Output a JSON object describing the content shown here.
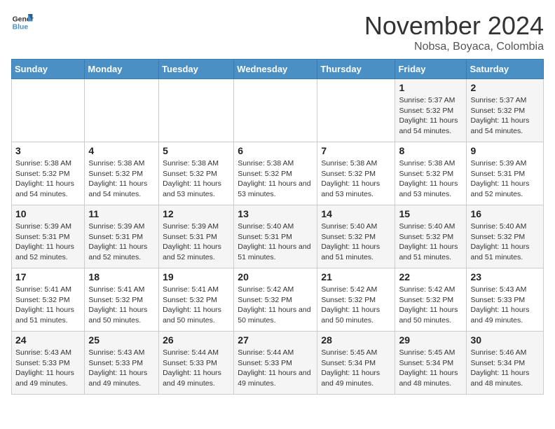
{
  "logo": {
    "line1": "General",
    "line2": "Blue"
  },
  "title": "November 2024",
  "location": "Nobsa, Boyaca, Colombia",
  "weekdays": [
    "Sunday",
    "Monday",
    "Tuesday",
    "Wednesday",
    "Thursday",
    "Friday",
    "Saturday"
  ],
  "weeks": [
    [
      {
        "day": "",
        "info": ""
      },
      {
        "day": "",
        "info": ""
      },
      {
        "day": "",
        "info": ""
      },
      {
        "day": "",
        "info": ""
      },
      {
        "day": "",
        "info": ""
      },
      {
        "day": "1",
        "info": "Sunrise: 5:37 AM\nSunset: 5:32 PM\nDaylight: 11 hours and 54 minutes."
      },
      {
        "day": "2",
        "info": "Sunrise: 5:37 AM\nSunset: 5:32 PM\nDaylight: 11 hours and 54 minutes."
      }
    ],
    [
      {
        "day": "3",
        "info": "Sunrise: 5:38 AM\nSunset: 5:32 PM\nDaylight: 11 hours and 54 minutes."
      },
      {
        "day": "4",
        "info": "Sunrise: 5:38 AM\nSunset: 5:32 PM\nDaylight: 11 hours and 54 minutes."
      },
      {
        "day": "5",
        "info": "Sunrise: 5:38 AM\nSunset: 5:32 PM\nDaylight: 11 hours and 53 minutes."
      },
      {
        "day": "6",
        "info": "Sunrise: 5:38 AM\nSunset: 5:32 PM\nDaylight: 11 hours and 53 minutes."
      },
      {
        "day": "7",
        "info": "Sunrise: 5:38 AM\nSunset: 5:32 PM\nDaylight: 11 hours and 53 minutes."
      },
      {
        "day": "8",
        "info": "Sunrise: 5:38 AM\nSunset: 5:32 PM\nDaylight: 11 hours and 53 minutes."
      },
      {
        "day": "9",
        "info": "Sunrise: 5:39 AM\nSunset: 5:31 PM\nDaylight: 11 hours and 52 minutes."
      }
    ],
    [
      {
        "day": "10",
        "info": "Sunrise: 5:39 AM\nSunset: 5:31 PM\nDaylight: 11 hours and 52 minutes."
      },
      {
        "day": "11",
        "info": "Sunrise: 5:39 AM\nSunset: 5:31 PM\nDaylight: 11 hours and 52 minutes."
      },
      {
        "day": "12",
        "info": "Sunrise: 5:39 AM\nSunset: 5:31 PM\nDaylight: 11 hours and 52 minutes."
      },
      {
        "day": "13",
        "info": "Sunrise: 5:40 AM\nSunset: 5:31 PM\nDaylight: 11 hours and 51 minutes."
      },
      {
        "day": "14",
        "info": "Sunrise: 5:40 AM\nSunset: 5:32 PM\nDaylight: 11 hours and 51 minutes."
      },
      {
        "day": "15",
        "info": "Sunrise: 5:40 AM\nSunset: 5:32 PM\nDaylight: 11 hours and 51 minutes."
      },
      {
        "day": "16",
        "info": "Sunrise: 5:40 AM\nSunset: 5:32 PM\nDaylight: 11 hours and 51 minutes."
      }
    ],
    [
      {
        "day": "17",
        "info": "Sunrise: 5:41 AM\nSunset: 5:32 PM\nDaylight: 11 hours and 51 minutes."
      },
      {
        "day": "18",
        "info": "Sunrise: 5:41 AM\nSunset: 5:32 PM\nDaylight: 11 hours and 50 minutes."
      },
      {
        "day": "19",
        "info": "Sunrise: 5:41 AM\nSunset: 5:32 PM\nDaylight: 11 hours and 50 minutes."
      },
      {
        "day": "20",
        "info": "Sunrise: 5:42 AM\nSunset: 5:32 PM\nDaylight: 11 hours and 50 minutes."
      },
      {
        "day": "21",
        "info": "Sunrise: 5:42 AM\nSunset: 5:32 PM\nDaylight: 11 hours and 50 minutes."
      },
      {
        "day": "22",
        "info": "Sunrise: 5:42 AM\nSunset: 5:32 PM\nDaylight: 11 hours and 50 minutes."
      },
      {
        "day": "23",
        "info": "Sunrise: 5:43 AM\nSunset: 5:33 PM\nDaylight: 11 hours and 49 minutes."
      }
    ],
    [
      {
        "day": "24",
        "info": "Sunrise: 5:43 AM\nSunset: 5:33 PM\nDaylight: 11 hours and 49 minutes."
      },
      {
        "day": "25",
        "info": "Sunrise: 5:43 AM\nSunset: 5:33 PM\nDaylight: 11 hours and 49 minutes."
      },
      {
        "day": "26",
        "info": "Sunrise: 5:44 AM\nSunset: 5:33 PM\nDaylight: 11 hours and 49 minutes."
      },
      {
        "day": "27",
        "info": "Sunrise: 5:44 AM\nSunset: 5:33 PM\nDaylight: 11 hours and 49 minutes."
      },
      {
        "day": "28",
        "info": "Sunrise: 5:45 AM\nSunset: 5:34 PM\nDaylight: 11 hours and 49 minutes."
      },
      {
        "day": "29",
        "info": "Sunrise: 5:45 AM\nSunset: 5:34 PM\nDaylight: 11 hours and 48 minutes."
      },
      {
        "day": "30",
        "info": "Sunrise: 5:46 AM\nSunset: 5:34 PM\nDaylight: 11 hours and 48 minutes."
      }
    ]
  ]
}
